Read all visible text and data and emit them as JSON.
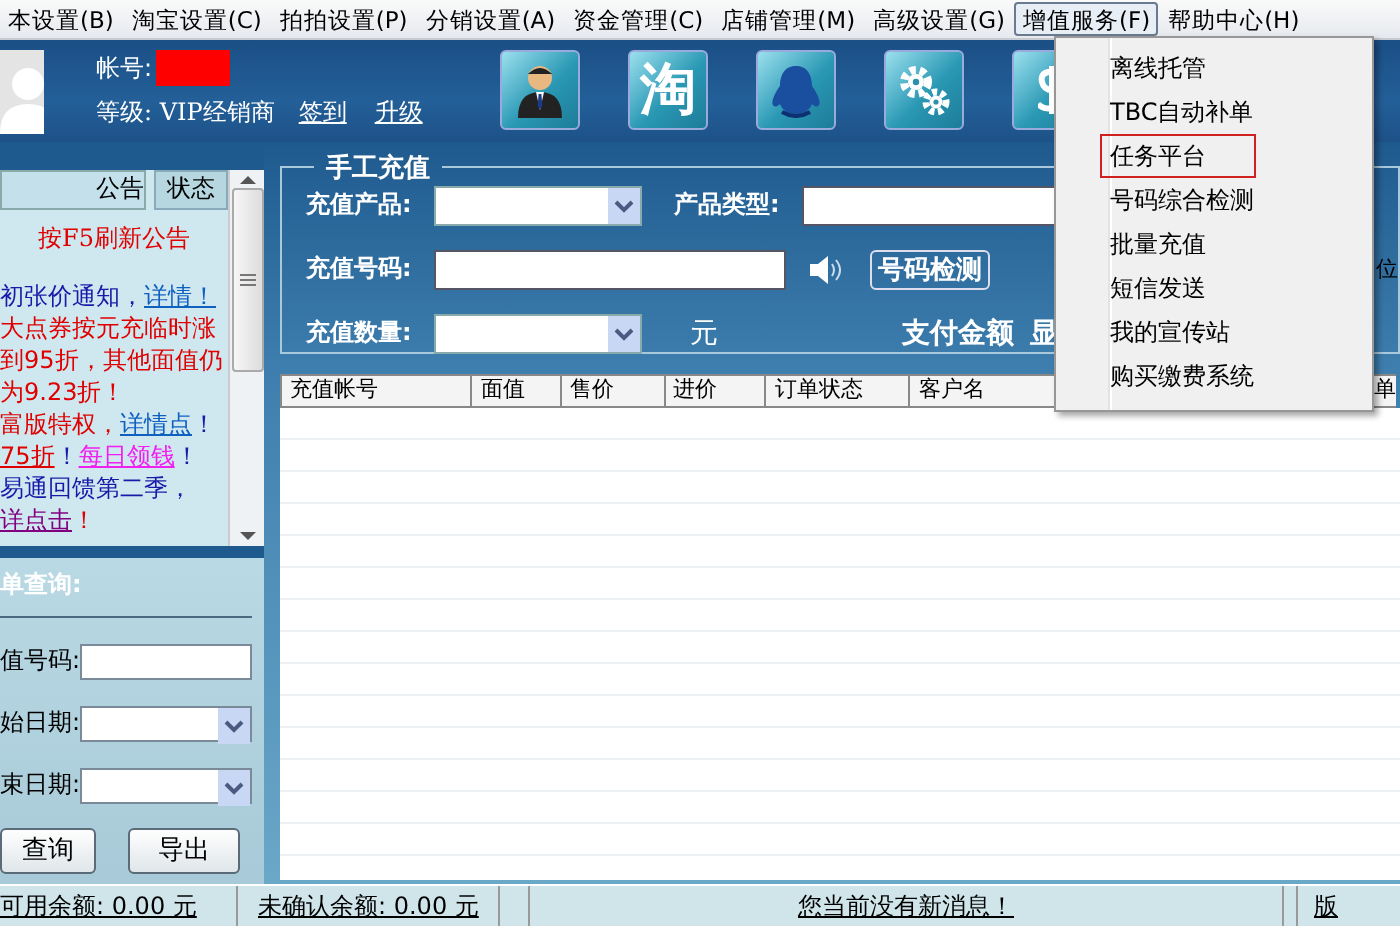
{
  "menubar": {
    "items": [
      {
        "label": "本设置(B)",
        "selected": false
      },
      {
        "label": "淘宝设置(C)",
        "selected": false
      },
      {
        "label": "拍拍设置(P)",
        "selected": false
      },
      {
        "label": "分销设置(A)",
        "selected": false
      },
      {
        "label": "资金管理(C)",
        "selected": false
      },
      {
        "label": "店铺管理(M)",
        "selected": false
      },
      {
        "label": "高级设置(G)",
        "selected": false
      },
      {
        "label": "增值服务(F)",
        "selected": true
      },
      {
        "label": "帮助中心(H)",
        "selected": false
      }
    ]
  },
  "dropdown": {
    "items": [
      {
        "label": "离线托管",
        "outlined": false
      },
      {
        "label": "TBC自动补单",
        "outlined": false
      },
      {
        "label": "任务平台",
        "outlined": true
      },
      {
        "label": "号码综合检测",
        "outlined": false
      },
      {
        "label": "批量充值",
        "outlined": false
      },
      {
        "label": "短信发送",
        "outlined": false
      },
      {
        "label": "我的宣传站",
        "outlined": false
      },
      {
        "label": "购买缴费系统",
        "outlined": false
      }
    ]
  },
  "account": {
    "account_label": "帐号:",
    "level_label": "等级: VIP经销商",
    "links": [
      "签到",
      "升级"
    ]
  },
  "toolbar": {
    "buttons": [
      {
        "kind": "person"
      },
      {
        "kind": "glyph",
        "label": "淘"
      },
      {
        "kind": "penguin"
      },
      {
        "kind": "gears"
      },
      {
        "kind": "dollar"
      }
    ]
  },
  "notice_panel": {
    "tabs": [
      {
        "label": "公告",
        "selected": true
      },
      {
        "label": "状态",
        "selected": false
      }
    ],
    "refresh_hint": "按F5刷新公告",
    "notices": [
      [
        {
          "text": "初张价通知，",
          "color": "#1a1aa8",
          "link": false
        },
        {
          "text": "详情！",
          "color": "#1060c0",
          "link": true
        }
      ],
      [
        {
          "text": "大点券按元充临时涨到95折，其他面值仍为9.23折！",
          "color": "#e00000",
          "link": false
        }
      ],
      [
        {
          "text": "富版特权，",
          "color": "#e00000",
          "link": false
        },
        {
          "text": "详情点",
          "color": "#1060c0",
          "link": true
        },
        {
          "text": "！",
          "color": "#1a1aa8",
          "link": false
        }
      ],
      [
        {
          "text": "75折",
          "color": "#e00000",
          "link": true
        },
        {
          "text": "！",
          "color": "#1a1aa8",
          "link": false
        },
        {
          "text": "每日领钱",
          "color": "#f020f0",
          "link": true
        },
        {
          "text": "！",
          "color": "#1a1aa8",
          "link": false
        }
      ],
      [
        {
          "text": "易通回馈第二季，",
          "color": "#1a1aa8",
          "link": false
        },
        {
          "text": "详点击",
          "color": "#800080",
          "link": true
        },
        {
          "text": "！",
          "color": "#e00000",
          "link": false
        }
      ]
    ]
  },
  "order_query": {
    "title": "单查询:",
    "fields": [
      {
        "label": "值号码:",
        "kind": "text"
      },
      {
        "label": "始日期:",
        "kind": "select"
      },
      {
        "label": "束日期:",
        "kind": "select"
      }
    ],
    "buttons": [
      "查询",
      "导出"
    ]
  },
  "manual_recharge": {
    "title": "手工充值",
    "product_label": "充值产品:",
    "type_label": "产品类型:",
    "number_label": "充值号码:",
    "check_button": "号码检测",
    "edge_text": "位",
    "quantity_label": "充值数量:",
    "unit": "元",
    "pay_label": "支付金额",
    "pay_cut": "显"
  },
  "table": {
    "columns": [
      "充值帐号",
      "面值",
      "售价",
      "进价",
      "订单状态",
      "客户名",
      "单"
    ]
  },
  "status_bar": {
    "items": [
      "可用余额: 0.00 元",
      "未确认余额: 0.00 元",
      "您当前没有新消息！",
      "版"
    ]
  }
}
